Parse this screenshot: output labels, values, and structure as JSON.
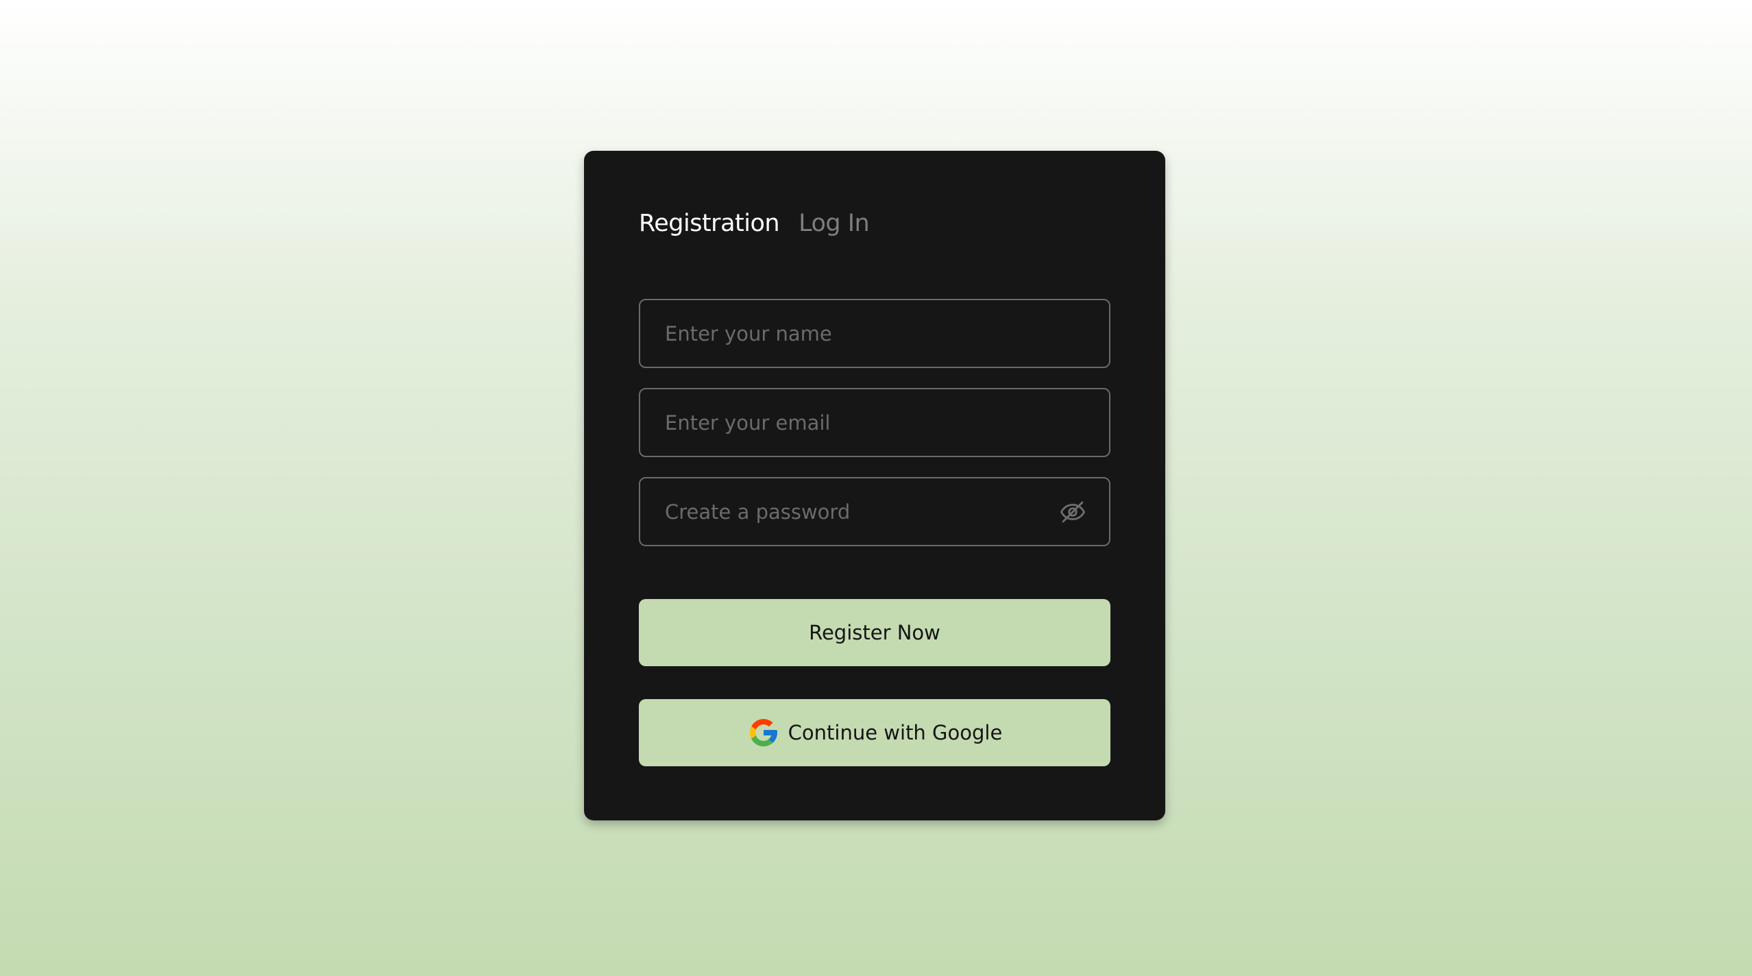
{
  "tabs": {
    "registration": "Registration",
    "login": "Log In"
  },
  "fields": {
    "name_placeholder": "Enter your name",
    "email_placeholder": "Enter your email",
    "password_placeholder": "Create a password",
    "password_toggle_icon": "eye-slash-icon"
  },
  "buttons": {
    "register": "Register Now",
    "google": "Continue with Google",
    "google_icon": "google-logo-icon"
  },
  "colors": {
    "card_background": "#161616",
    "button_accent": "#c4dbb1",
    "active_tab": "#ffffff",
    "inactive_tab": "#7e7e7e"
  }
}
